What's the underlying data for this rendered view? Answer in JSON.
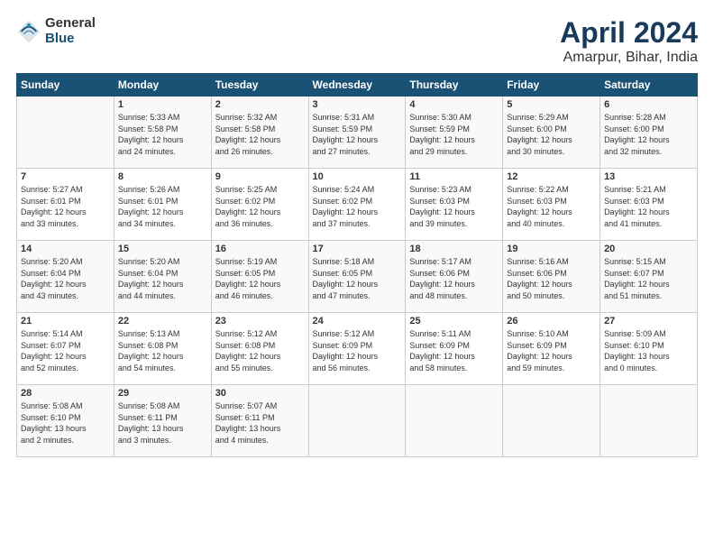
{
  "header": {
    "logo_general": "General",
    "logo_blue": "Blue",
    "title": "April 2024",
    "location": "Amarpur, Bihar, India"
  },
  "columns": [
    "Sunday",
    "Monday",
    "Tuesday",
    "Wednesday",
    "Thursday",
    "Friday",
    "Saturday"
  ],
  "weeks": [
    [
      {
        "day": "",
        "content": ""
      },
      {
        "day": "1",
        "content": "Sunrise: 5:33 AM\nSunset: 5:58 PM\nDaylight: 12 hours\nand 24 minutes."
      },
      {
        "day": "2",
        "content": "Sunrise: 5:32 AM\nSunset: 5:58 PM\nDaylight: 12 hours\nand 26 minutes."
      },
      {
        "day": "3",
        "content": "Sunrise: 5:31 AM\nSunset: 5:59 PM\nDaylight: 12 hours\nand 27 minutes."
      },
      {
        "day": "4",
        "content": "Sunrise: 5:30 AM\nSunset: 5:59 PM\nDaylight: 12 hours\nand 29 minutes."
      },
      {
        "day": "5",
        "content": "Sunrise: 5:29 AM\nSunset: 6:00 PM\nDaylight: 12 hours\nand 30 minutes."
      },
      {
        "day": "6",
        "content": "Sunrise: 5:28 AM\nSunset: 6:00 PM\nDaylight: 12 hours\nand 32 minutes."
      }
    ],
    [
      {
        "day": "7",
        "content": "Sunrise: 5:27 AM\nSunset: 6:01 PM\nDaylight: 12 hours\nand 33 minutes."
      },
      {
        "day": "8",
        "content": "Sunrise: 5:26 AM\nSunset: 6:01 PM\nDaylight: 12 hours\nand 34 minutes."
      },
      {
        "day": "9",
        "content": "Sunrise: 5:25 AM\nSunset: 6:02 PM\nDaylight: 12 hours\nand 36 minutes."
      },
      {
        "day": "10",
        "content": "Sunrise: 5:24 AM\nSunset: 6:02 PM\nDaylight: 12 hours\nand 37 minutes."
      },
      {
        "day": "11",
        "content": "Sunrise: 5:23 AM\nSunset: 6:03 PM\nDaylight: 12 hours\nand 39 minutes."
      },
      {
        "day": "12",
        "content": "Sunrise: 5:22 AM\nSunset: 6:03 PM\nDaylight: 12 hours\nand 40 minutes."
      },
      {
        "day": "13",
        "content": "Sunrise: 5:21 AM\nSunset: 6:03 PM\nDaylight: 12 hours\nand 41 minutes."
      }
    ],
    [
      {
        "day": "14",
        "content": "Sunrise: 5:20 AM\nSunset: 6:04 PM\nDaylight: 12 hours\nand 43 minutes."
      },
      {
        "day": "15",
        "content": "Sunrise: 5:20 AM\nSunset: 6:04 PM\nDaylight: 12 hours\nand 44 minutes."
      },
      {
        "day": "16",
        "content": "Sunrise: 5:19 AM\nSunset: 6:05 PM\nDaylight: 12 hours\nand 46 minutes."
      },
      {
        "day": "17",
        "content": "Sunrise: 5:18 AM\nSunset: 6:05 PM\nDaylight: 12 hours\nand 47 minutes."
      },
      {
        "day": "18",
        "content": "Sunrise: 5:17 AM\nSunset: 6:06 PM\nDaylight: 12 hours\nand 48 minutes."
      },
      {
        "day": "19",
        "content": "Sunrise: 5:16 AM\nSunset: 6:06 PM\nDaylight: 12 hours\nand 50 minutes."
      },
      {
        "day": "20",
        "content": "Sunrise: 5:15 AM\nSunset: 6:07 PM\nDaylight: 12 hours\nand 51 minutes."
      }
    ],
    [
      {
        "day": "21",
        "content": "Sunrise: 5:14 AM\nSunset: 6:07 PM\nDaylight: 12 hours\nand 52 minutes."
      },
      {
        "day": "22",
        "content": "Sunrise: 5:13 AM\nSunset: 6:08 PM\nDaylight: 12 hours\nand 54 minutes."
      },
      {
        "day": "23",
        "content": "Sunrise: 5:12 AM\nSunset: 6:08 PM\nDaylight: 12 hours\nand 55 minutes."
      },
      {
        "day": "24",
        "content": "Sunrise: 5:12 AM\nSunset: 6:09 PM\nDaylight: 12 hours\nand 56 minutes."
      },
      {
        "day": "25",
        "content": "Sunrise: 5:11 AM\nSunset: 6:09 PM\nDaylight: 12 hours\nand 58 minutes."
      },
      {
        "day": "26",
        "content": "Sunrise: 5:10 AM\nSunset: 6:09 PM\nDaylight: 12 hours\nand 59 minutes."
      },
      {
        "day": "27",
        "content": "Sunrise: 5:09 AM\nSunset: 6:10 PM\nDaylight: 13 hours\nand 0 minutes."
      }
    ],
    [
      {
        "day": "28",
        "content": "Sunrise: 5:08 AM\nSunset: 6:10 PM\nDaylight: 13 hours\nand 2 minutes."
      },
      {
        "day": "29",
        "content": "Sunrise: 5:08 AM\nSunset: 6:11 PM\nDaylight: 13 hours\nand 3 minutes."
      },
      {
        "day": "30",
        "content": "Sunrise: 5:07 AM\nSunset: 6:11 PM\nDaylight: 13 hours\nand 4 minutes."
      },
      {
        "day": "",
        "content": ""
      },
      {
        "day": "",
        "content": ""
      },
      {
        "day": "",
        "content": ""
      },
      {
        "day": "",
        "content": ""
      }
    ]
  ]
}
